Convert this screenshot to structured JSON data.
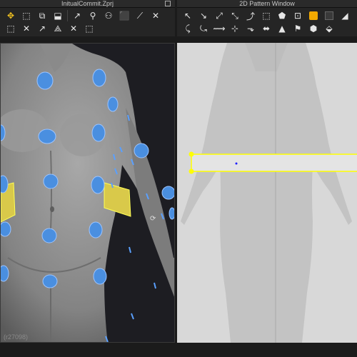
{
  "window_3d": {
    "title": "InitualCommit.Zprj",
    "version_label": "(r27098)"
  },
  "window_2d": {
    "title": "2D Pattern Window"
  },
  "toolbar_3d": {
    "icons": [
      "select-move-icon",
      "transform-icon",
      "select-mesh-icon",
      "fold-arrange-icon",
      "select-pin-icon",
      "tack-icon",
      "show-avatar-icon",
      "simulation-icon",
      "sew-icon",
      "pin-icon",
      "trim-icon",
      "measure-icon",
      "iron-icon",
      "fit-icon",
      "strap-icon",
      "graphic-icon"
    ]
  },
  "toolbar_2d": {
    "icons": [
      "transform-pattern-icon",
      "edit-point-icon",
      "edit-curve-icon",
      "curve-point-icon",
      "add-point-icon",
      "create-rectangle-icon",
      "polygon-icon",
      "internal-line-icon",
      "dart-icon",
      "seam-icon",
      "fold-icon",
      "fill-color-icon",
      "sewing-icon",
      "free-sewing-icon",
      "segment-sewing-icon",
      "tack-2d-icon",
      "fabric-icon",
      "texture-icon",
      "topstitch-icon",
      "button-icon",
      "zipper-icon"
    ]
  },
  "colors": {
    "accent": "#f2a900",
    "selection": "#ffff00",
    "pin_blue": "#4a90e2",
    "avatar_gray": "#8e8e8e",
    "pattern_bg": "#d8d8d8"
  }
}
